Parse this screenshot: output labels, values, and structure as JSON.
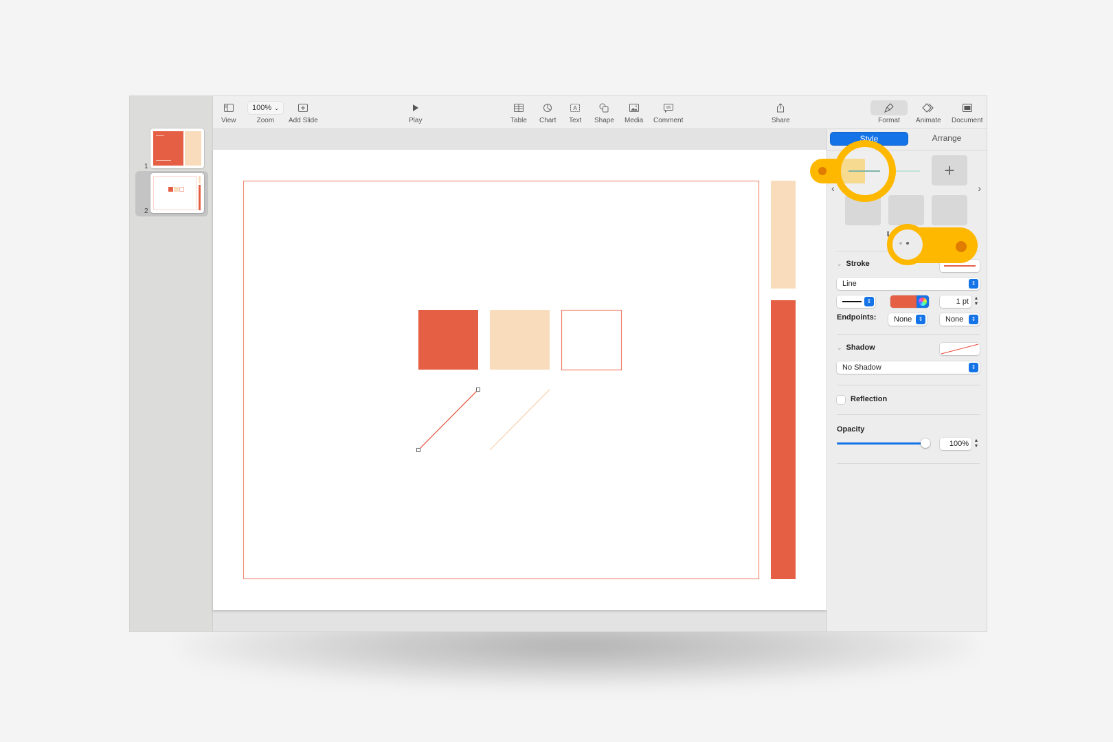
{
  "toolbar": {
    "view": {
      "label": "View",
      "icon": "sidebar-icon"
    },
    "zoom": {
      "label": "Zoom",
      "value": "100%",
      "icon": "chevron-down-icon"
    },
    "add_slide": {
      "label": "Add Slide",
      "icon": "add-slide-icon"
    },
    "play": {
      "label": "Play",
      "icon": "play-icon"
    },
    "table": {
      "label": "Table",
      "icon": "table-icon"
    },
    "chart": {
      "label": "Chart",
      "icon": "chart-icon"
    },
    "text": {
      "label": "Text",
      "icon": "text-box-icon"
    },
    "shape": {
      "label": "Shape",
      "icon": "shape-icon"
    },
    "media": {
      "label": "Media",
      "icon": "media-icon"
    },
    "comment": {
      "label": "Comment",
      "icon": "comment-icon"
    },
    "share": {
      "label": "Share",
      "icon": "share-icon"
    },
    "format": {
      "label": "Format",
      "icon": "paintbrush-icon",
      "active": true
    },
    "animate": {
      "label": "Animate",
      "icon": "diamond-icon"
    },
    "document": {
      "label": "Document",
      "icon": "document-icon"
    }
  },
  "slides": [
    {
      "number": "1",
      "selected": false
    },
    {
      "number": "2",
      "selected": true
    }
  ],
  "colors": {
    "accent_red": "#e55f45",
    "peach": "#f8dcbb",
    "system_blue": "#1473e6",
    "callout_yellow": "#ffb800",
    "callout_dot": "#e07c00",
    "line_style_teal": "#7fb5a8"
  },
  "inspector": {
    "tabs": [
      {
        "label": "Style",
        "active": true
      },
      {
        "label": "Arrange",
        "active": false
      }
    ],
    "styles_caption": "Line Styles",
    "styles_page_count": 2,
    "styles_page_active": 2,
    "add_style_icon": "plus-icon",
    "prev_icon": "chevron-left-icon",
    "next_icon": "chevron-right-icon",
    "stroke": {
      "title": "Stroke",
      "type": "Line",
      "color": "#e55f45",
      "width": "1 pt",
      "endpoints_label": "Endpoints:",
      "endpoint_start": "None",
      "endpoint_end": "None"
    },
    "shadow": {
      "title": "Shadow",
      "value": "No Shadow"
    },
    "reflection": {
      "label": "Reflection",
      "checked": false
    },
    "opacity": {
      "label": "Opacity",
      "value": "100%",
      "fraction": 1.0
    }
  }
}
